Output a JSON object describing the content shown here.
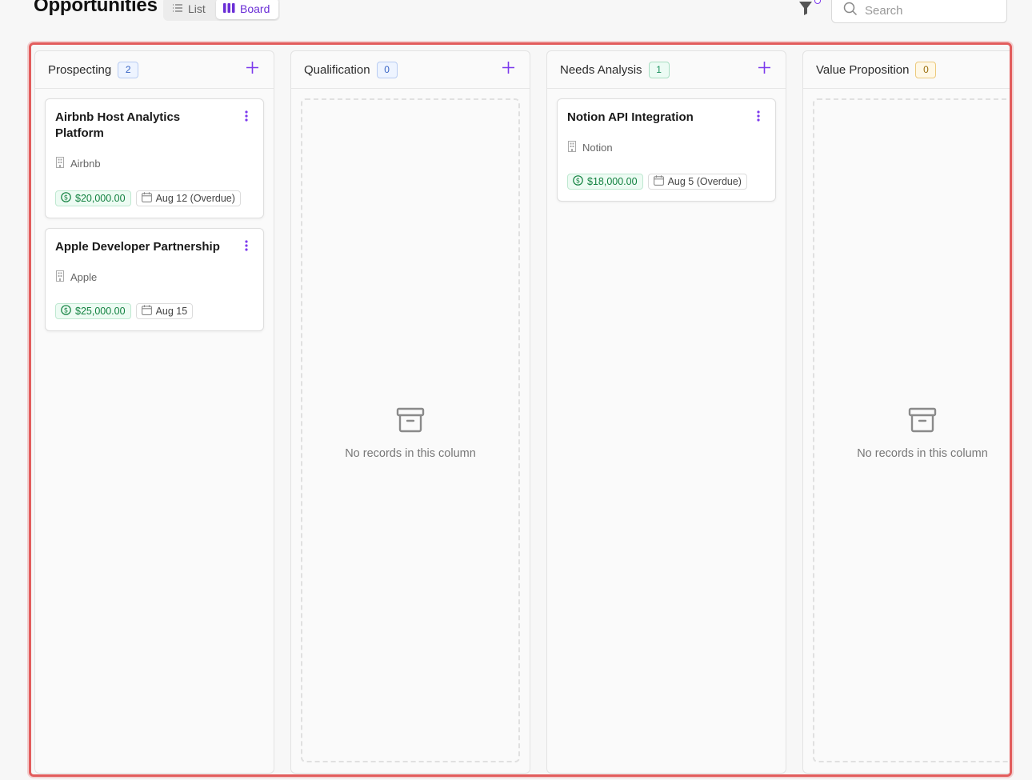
{
  "header": {
    "title": "Opportunities",
    "views": [
      {
        "label": "List",
        "icon": "list-icon",
        "active": false
      },
      {
        "label": "Board",
        "icon": "board-icon",
        "active": true
      }
    ],
    "search_placeholder": "Search",
    "accent_color": "#6b2fd6"
  },
  "board": {
    "empty_message": "No records in this column",
    "columns": [
      {
        "title": "Prospecting",
        "count": "2",
        "cards": [
          {
            "title": "Airbnb Host Analytics Platform",
            "company": "Airbnb",
            "amount": "$20,000.00",
            "date": "Aug 12 (Overdue)"
          },
          {
            "title": "Apple Developer Partnership",
            "company": "Apple",
            "amount": "$25,000.00",
            "date": "Aug 15"
          }
        ]
      },
      {
        "title": "Qualification",
        "count": "0",
        "cards": []
      },
      {
        "title": "Needs Analysis",
        "count": "1",
        "cards": [
          {
            "title": "Notion API Integration",
            "company": "Notion",
            "amount": "$18,000.00",
            "date": "Aug 5 (Overdue)"
          }
        ]
      },
      {
        "title": "Value Proposition",
        "count": "0",
        "cards": []
      }
    ]
  }
}
